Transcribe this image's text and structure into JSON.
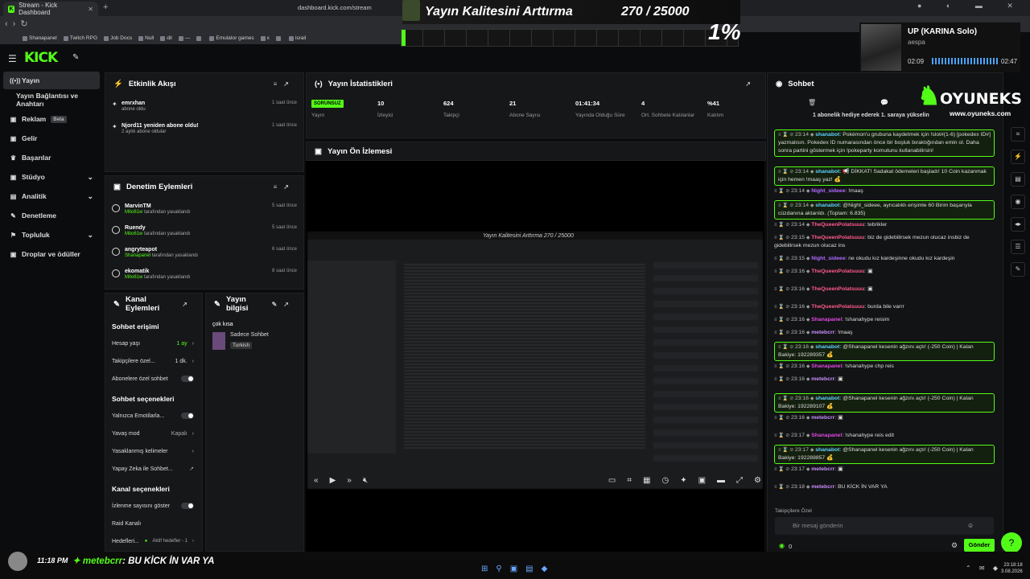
{
  "browser": {
    "tab_title": "Stream - Kick Dashboard",
    "url": "dashboard.kick.com/stream",
    "bookmarks": [
      "Shanapanel",
      "Twitch RPG",
      "Job Docs",
      "Null",
      "dil",
      "—",
      "",
      "Emulator games",
      "x",
      "",
      "israil"
    ]
  },
  "overlay": {
    "title": "Yayın Kalitesini Arttırma",
    "count": "270 / 25000",
    "percent": "1%",
    "progress": 0.011
  },
  "music": {
    "song": "UP (KARINA Solo)",
    "artist": "aespa",
    "elapsed": "02:09",
    "duration": "02:47"
  },
  "sidebar": {
    "items": [
      {
        "label": "Yayın",
        "icon": "stream-icon",
        "active": true
      },
      {
        "label": "Yayın Bağlantısı ve Anahtarı",
        "icon": ""
      },
      {
        "label": "Reklam",
        "icon": "ad-icon",
        "badge": "Beta"
      },
      {
        "label": "Gelir",
        "icon": "wallet-icon"
      },
      {
        "label": "Başarılar",
        "icon": "trophy-icon"
      },
      {
        "label": "Stüdyo",
        "icon": "studio-icon",
        "chevron": true
      },
      {
        "label": "Analitik",
        "icon": "chart-icon",
        "chevron": true
      },
      {
        "label": "Denetleme",
        "icon": "hammer-icon"
      },
      {
        "label": "Topluluk",
        "icon": "people-icon",
        "chevron": true
      },
      {
        "label": "Droplar ve ödüller",
        "icon": "gift-icon"
      }
    ]
  },
  "activity": {
    "title": "Etkinlik Akışı",
    "items": [
      {
        "user": "emrxhan",
        "desc": "abone oldu",
        "time": "1 saat önce"
      },
      {
        "user": "Njord11 yeniden abone oldu!",
        "desc": "2 aylık abone oldular",
        "time": "1 saat önce"
      }
    ]
  },
  "moderation": {
    "title": "Denetim Eylemleri",
    "items": [
      {
        "user": "MarvinTM",
        "mod": "Mito61w",
        "desc": "tarafından yasaklandı",
        "time": "5 saat önce"
      },
      {
        "user": "Ruendy",
        "mod": "Mito61w",
        "desc": "tarafından yasaklandı",
        "time": "5 saat önce"
      },
      {
        "user": "angryteapot",
        "mod": "Shanapanel",
        "desc": "tarafından yasaklandı",
        "time": "6 saat önce"
      },
      {
        "user": "ekomatik",
        "mod": "Mito61w",
        "desc": "tarafından yasaklandı",
        "time": "8 saat önce"
      }
    ]
  },
  "channel": {
    "title": "Kanal Eylemleri",
    "chat_access": "Sohbet erişimi",
    "account_age": "Hesap yaşı",
    "account_age_val": "1 ay",
    "followers_only": "Takipçilere özel...",
    "followers_val": "1 dk.",
    "subs_only": "Abonelere özel sohbet",
    "chat_options": "Sohbet seçenekleri",
    "emotes_only": "Yalnızca Emotilarla...",
    "slow_mode": "Yavaş mod",
    "slow_val": "Kapalı",
    "banned_words": "Yasaklanmış kelimeler",
    "ai_chat": "Yapay Zeka ile Sohbet...",
    "channel_options": "Kanal seçenekleri",
    "show_views": "İzlenme sayısını göster",
    "raid": "Raid Kanalı",
    "goals": "Hedefleri...",
    "goals_val": "Aktif hedefler - 1"
  },
  "info": {
    "title": "Yayın bilgisi",
    "stream_title": "çok kısa",
    "category": "Sadece Sohbet",
    "language": "Turkish"
  },
  "stats": {
    "title": "Yayın İstatistikleri",
    "items": [
      {
        "v": "SORUNSUZ",
        "l": "Yayın",
        "badge": true
      },
      {
        "v": "10",
        "l": "İzleyici"
      },
      {
        "v": "624",
        "l": "Takipçi"
      },
      {
        "v": "21",
        "l": "Abone Sayısı"
      },
      {
        "v": "01:41:34",
        "l": "Yayında Olduğu Süre"
      },
      {
        "v": "4",
        "l": "Ort. Sohbete Katılanlar"
      },
      {
        "v": "%41",
        "l": "Katılım"
      }
    ]
  },
  "preview": {
    "title": "Yayın Ön İzlemesi",
    "inner_title": "Yayın Kalitesini Arttırma   270 / 25000"
  },
  "chat": {
    "title": "Sohbet",
    "pinned": "1 abonelik hediye ederek 1. saraya yükselin",
    "placeholder": "Bir mesaj gönderin",
    "send": "Gönder",
    "followers": "Takipçilere Özel",
    "points": "0",
    "messages": [
      {
        "t": "23:14",
        "u": "shanabot",
        "c": "u-sh",
        "m": "Pokémon'u grubuna kaydetmek için !slot#(1-6) [pokedex ID#] yazmalısın. Pokedex ID numarasından önce bir boşluk bıraktığından emin ol. Daha sonra partini göstermek için !pokeparty komutunu kullanabilirsin!",
        "hl": true,
        "h": 42
      },
      {
        "t": "23:14",
        "u": "shanabot",
        "c": "u-sh",
        "m": "📢 DİKKAT! Sadakat ödemeleri başladı! 10 Coin kazanmak için hemen !maaş yaz! 💰",
        "hl": true,
        "h": 22
      },
      {
        "t": "23:14",
        "u": "Night_sideee",
        "c": "u-ns",
        "m": "!maaş",
        "h": 12
      },
      {
        "t": "23:14",
        "u": "shanabot",
        "c": "u-sh",
        "m": "@Night_sideee, ayrıcalıklı erişimle 60 Birim başarıyla cüzdanına aktarıldı. (Toplam: 6.835)",
        "hl": true,
        "h": 22
      },
      {
        "t": "23:14",
        "u": "TheQueenPolatsuuu",
        "c": "u-q",
        "m": "tebrikler",
        "h": 12
      },
      {
        "t": "23:15",
        "u": "TheQueenPolatsuuu",
        "c": "u-q",
        "m": "biz de gidebilirsek mezun olucaz insbiz de gidebilirsek mezun olucaz ins",
        "h": 22
      },
      {
        "t": "23:15",
        "u": "Night_sideee",
        "c": "u-ns",
        "m": "ne okudu kız kardeşinne okudu kız kardeşin",
        "h": 12
      },
      {
        "t": "23:16",
        "u": "TheQueenPolatsuuu",
        "c": "u-q",
        "m": "▣",
        "h": 18
      },
      {
        "t": "23:16",
        "u": "TheQueenPolatsuuu",
        "c": "u-q",
        "m": "▣",
        "h": 18
      },
      {
        "t": "23:16",
        "u": "TheQueenPolatsuuu",
        "c": "u-q",
        "m": "burda bile varrr",
        "h": 12
      },
      {
        "t": "23:16",
        "u": "Shanapanel",
        "c": "u-sp",
        "m": "!shanahype reisim",
        "h": 12
      },
      {
        "t": "23:16",
        "u": "metebcrr",
        "c": "u-m",
        "m": "!maaş",
        "h": 12
      },
      {
        "t": "23:16",
        "u": "shanabot",
        "c": "u-sh",
        "m": "@Shanapanel kesenin ağzını açtı! (-250 Coin) | Kalan Bakiye: 192289357 💰",
        "hl": true,
        "h": 22
      },
      {
        "t": "23:16",
        "u": "Shanapanel",
        "c": "u-sp",
        "m": "!shanahype chp reis",
        "h": 12
      },
      {
        "t": "23:16",
        "u": "metebcrr",
        "c": "u-m",
        "m": "▣",
        "h": 18
      },
      {
        "t": "23:16",
        "u": "shanabot",
        "c": "u-sh",
        "m": "@Shanapanel kesenin ağzını açtı! (-250 Coin) | Kalan Bakiye: 192289107 💰",
        "hl": true,
        "h": 22
      },
      {
        "t": "23:16",
        "u": "metebcrr",
        "c": "u-m",
        "m": "▣",
        "h": 18
      },
      {
        "t": "23:17",
        "u": "Shanapanel",
        "c": "u-sp",
        "m": "!shanahype reis edit",
        "h": 12
      },
      {
        "t": "23:17",
        "u": "shanabot",
        "c": "u-sh",
        "m": "@Shanapanel kesenin ağzını açtı! (-250 Coin) | Kalan Bakiye: 192288857 💰",
        "hl": true,
        "h": 22
      },
      {
        "t": "23:17",
        "u": "metebcrr",
        "c": "u-m",
        "m": "▣",
        "h": 18
      },
      {
        "t": "23:18",
        "u": "metebcrr",
        "c": "u-m",
        "m": "BU KİCK İN VAR YA",
        "h": 12
      }
    ]
  },
  "brand": {
    "name": "OYUNEKS",
    "url": "www.oyuneks.com"
  },
  "bottom": {
    "time": "11:18 PM",
    "user": "metebcrr",
    "msg": ": BU KİCK İN VAR YA",
    "clock": "23:18:18",
    "date": "3.08.2026"
  }
}
